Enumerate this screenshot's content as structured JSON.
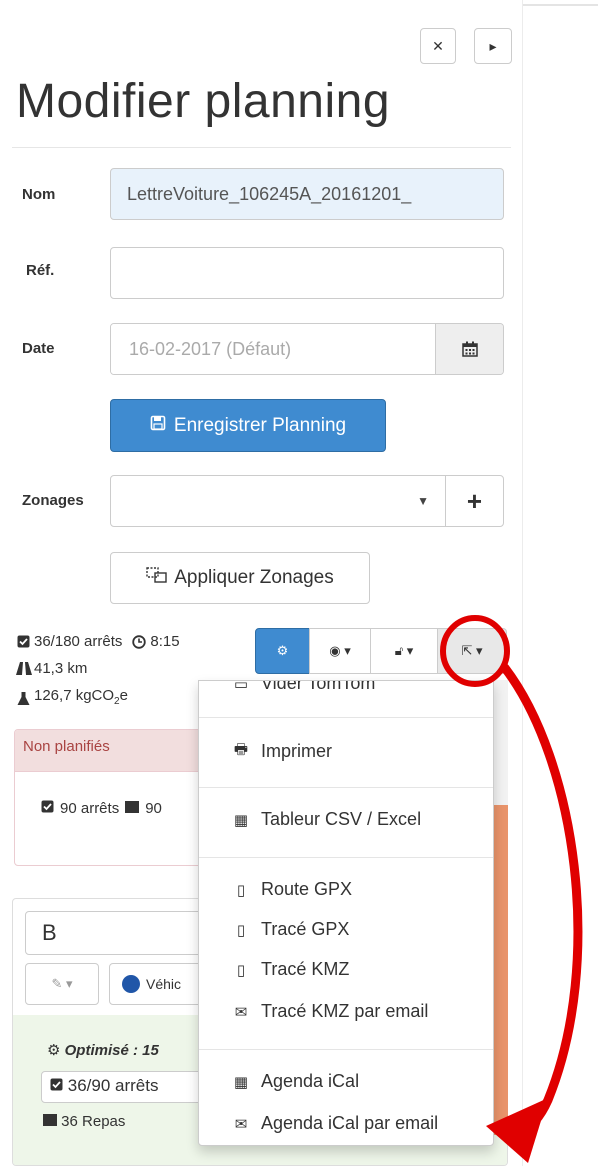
{
  "header": {
    "title": "Modifier planning",
    "expand_icon": "compress-arrows-icon",
    "next_icon": "caret-right-icon"
  },
  "form": {
    "nom_label": "Nom",
    "nom_value": "LettreVoiture_106245A_20161201_",
    "ref_label": "Réf.",
    "ref_value": "",
    "date_label": "Date",
    "date_placeholder": "16-02-2017 (Défaut)",
    "save_label": "Enregistrer Planning",
    "zonages_label": "Zonages",
    "zonages_value": "",
    "apply_label": "Appliquer Zonages"
  },
  "stats": {
    "stops": "36/180 arrêts",
    "duration": "8:15",
    "distance": "41,3 km",
    "co2": "126,7 kgCO",
    "co2_sub": "2",
    "co2_suffix": "e"
  },
  "unplanned": {
    "title": "Non planifiés",
    "stops": "90 arrêts",
    "count": "90"
  },
  "route": {
    "name": "B",
    "vehicle": "Véhic",
    "optimized": "Optimisé : 15",
    "stops": "36/90 arrêts",
    "meals": "36 Repas"
  },
  "export_menu": {
    "items": [
      {
        "icon": "tablet-icon",
        "label": "Vider TomTom"
      },
      {
        "icon": "print-icon",
        "label": "Imprimer"
      },
      {
        "icon": "table-icon",
        "label": "Tableur CSV / Excel"
      },
      {
        "icon": "mobile-icon",
        "label": "Route GPX"
      },
      {
        "icon": "mobile-icon",
        "label": "Tracé GPX"
      },
      {
        "icon": "mobile-icon",
        "label": "Tracé KMZ"
      },
      {
        "icon": "envelope-icon",
        "label": "Tracé KMZ par email"
      },
      {
        "icon": "calendar-icon",
        "label": "Agenda iCal"
      },
      {
        "icon": "envelope-icon",
        "label": "Agenda iCal par email"
      }
    ]
  },
  "colors": {
    "primary": "#3f8bd0",
    "danger_bg": "#f2dede",
    "success_bg": "#eef6e9",
    "annotation_red": "#e00000",
    "scroll_orange": "#e9946b"
  }
}
